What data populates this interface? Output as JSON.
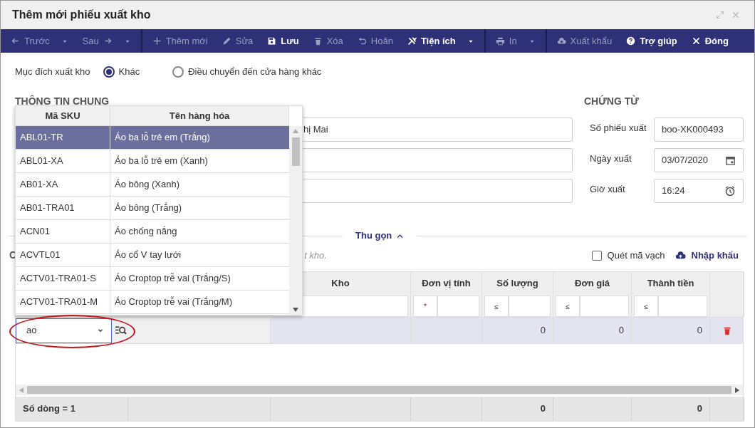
{
  "window": {
    "title": "Thêm mới phiếu xuất kho"
  },
  "toolbar": [
    {
      "label": "Trước",
      "disabled": true
    },
    {
      "label": "Sau",
      "disabled": true
    },
    {
      "label": "Thêm mới",
      "disabled": true
    },
    {
      "label": "Sửa",
      "disabled": true
    },
    {
      "label": "Lưu",
      "disabled": false
    },
    {
      "label": "Xóa",
      "disabled": true
    },
    {
      "label": "Hoãn",
      "disabled": true
    },
    {
      "label": "Tiện ích",
      "disabled": false
    },
    {
      "label": "In",
      "disabled": true
    },
    {
      "label": "Xuất khẩu",
      "disabled": true
    },
    {
      "label": "Trợ giúp",
      "disabled": false
    },
    {
      "label": "Đóng",
      "disabled": false
    }
  ],
  "purpose": {
    "label": "Mục đích xuất kho",
    "options": [
      {
        "label": "Khác",
        "selected": true
      },
      {
        "label": "Điều chuyển đến cửa hàng khác",
        "selected": false
      }
    ]
  },
  "general": {
    "heading": "THÔNG TIN CHUNG",
    "fields": [
      {
        "kind": "text",
        "value": "hị Mai"
      },
      {
        "kind": "text"
      },
      {
        "kind": "text"
      }
    ]
  },
  "voucher": {
    "heading": "CHỨNG TỪ",
    "fields": [
      {
        "label": "Số phiếu xuất",
        "value": "boo-XK000493",
        "kind": "text"
      },
      {
        "label": "Ngày xuất",
        "value": "03/07/2020",
        "kind": "date"
      },
      {
        "label": "Giờ xuất",
        "value": "16:24",
        "kind": "time"
      }
    ]
  },
  "collapse": {
    "label": "Thu gọn"
  },
  "details": {
    "heading": "C",
    "hint": "t kho.",
    "barcode": {
      "label": "Quét mã vạch",
      "checked": false
    },
    "import": "Nhập khẩu"
  },
  "table": {
    "columns": [
      {
        "label": "Kho"
      },
      {
        "label": "Đơn vị tính",
        "operator": "*"
      },
      {
        "label": "Số lượng",
        "operator": "≤"
      },
      {
        "label": "Đơn giá",
        "operator": "≤"
      },
      {
        "label": "Thành tiền",
        "operator": "≤"
      }
    ],
    "rows": [
      {
        "sku_input": "ao",
        "quantity": "0",
        "price": "0",
        "amount": "0"
      }
    ],
    "footer": {
      "row_count": "Số dòng = 1",
      "quantity": "0",
      "amount": "0"
    }
  },
  "dropdown": {
    "columns": [
      "Mã SKU",
      "Tên hàng hóa"
    ],
    "rows": [
      {
        "sku": "ABL01-TR",
        "name": "Áo ba lỗ trẻ em (Trắng)",
        "selected": true
      },
      {
        "sku": "ABL01-XA",
        "name": "Áo ba lỗ trẻ em (Xanh)",
        "selected": false
      },
      {
        "sku": "AB01-XA",
        "name": "Áo bông (Xanh)",
        "selected": false
      },
      {
        "sku": "AB01-TRA01",
        "name": "Áo bông (Trắng)",
        "selected": false
      },
      {
        "sku": "ACN01",
        "name": "Áo chống nắng",
        "selected": false
      },
      {
        "sku": "ACVTL01",
        "name": "Áo cổ V tay lưới",
        "selected": false
      },
      {
        "sku": "ACTV01-TRA01-S",
        "name": "Áo Croptop trễ vai (Trắng/S)",
        "selected": false
      },
      {
        "sku": "ACTV01-TRA01-M",
        "name": "Áo Croptop trễ vai (Trắng/M)",
        "selected": false
      }
    ]
  }
}
